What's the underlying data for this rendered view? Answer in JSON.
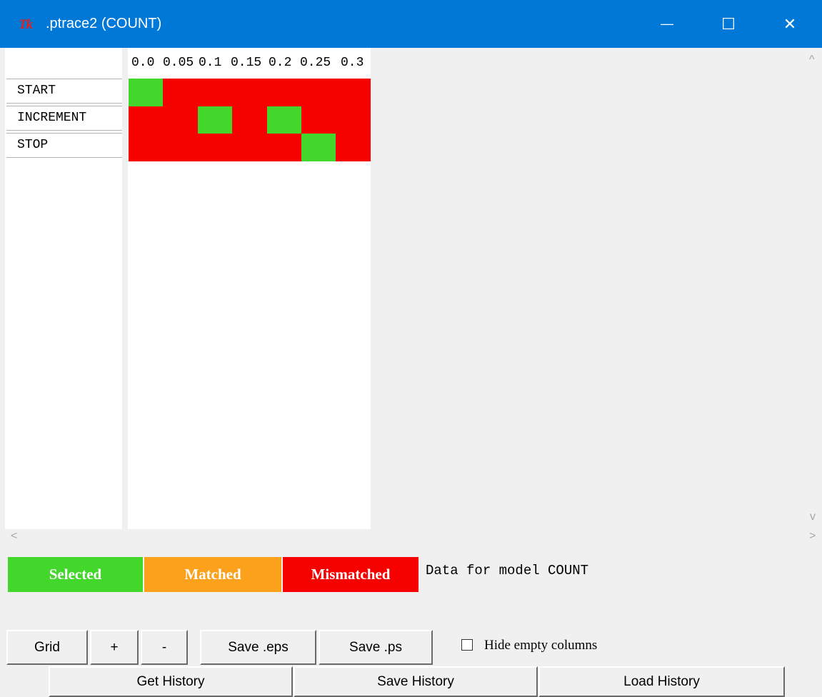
{
  "window": {
    "app_icon": "Tk",
    "title": ".ptrace2 (COUNT)",
    "minimize_glyph": "—",
    "maximize_glyph": "☐",
    "close_glyph": "✕"
  },
  "trace": {
    "x_ticks": [
      "0.0",
      "0.05",
      "0.1",
      "0.15",
      "0.2",
      "0.25",
      "0.3"
    ],
    "rows": [
      "START",
      "INCREMENT",
      "STOP"
    ],
    "columns": 7,
    "cell_states": [
      [
        "selected",
        "mismatched",
        "mismatched",
        "mismatched",
        "mismatched",
        "mismatched",
        "mismatched"
      ],
      [
        "mismatched",
        "mismatched",
        "selected",
        "mismatched",
        "selected",
        "mismatched",
        "mismatched"
      ],
      [
        "mismatched",
        "mismatched",
        "mismatched",
        "mismatched",
        "mismatched",
        "selected",
        "mismatched"
      ]
    ]
  },
  "colors": {
    "selected": "#43d62b",
    "matched": "#fba11c",
    "mismatched": "#f70000",
    "titlebar": "#0078d7"
  },
  "legend": {
    "selected_label": "Selected",
    "matched_label": "Matched",
    "mismatched_label": "Mismatched",
    "info": "Data for model COUNT"
  },
  "toolbar": {
    "grid": "Grid",
    "plus": "+",
    "minus": "-",
    "save_eps": "Save .eps",
    "save_ps": "Save .ps",
    "hide_empty_label": "Hide empty columns",
    "hide_empty_checked": false
  },
  "history": {
    "get": "Get History",
    "save": "Save History",
    "load": "Load History"
  },
  "scroll": {
    "up": "^",
    "down": "v",
    "left": "<",
    "right": ">"
  }
}
